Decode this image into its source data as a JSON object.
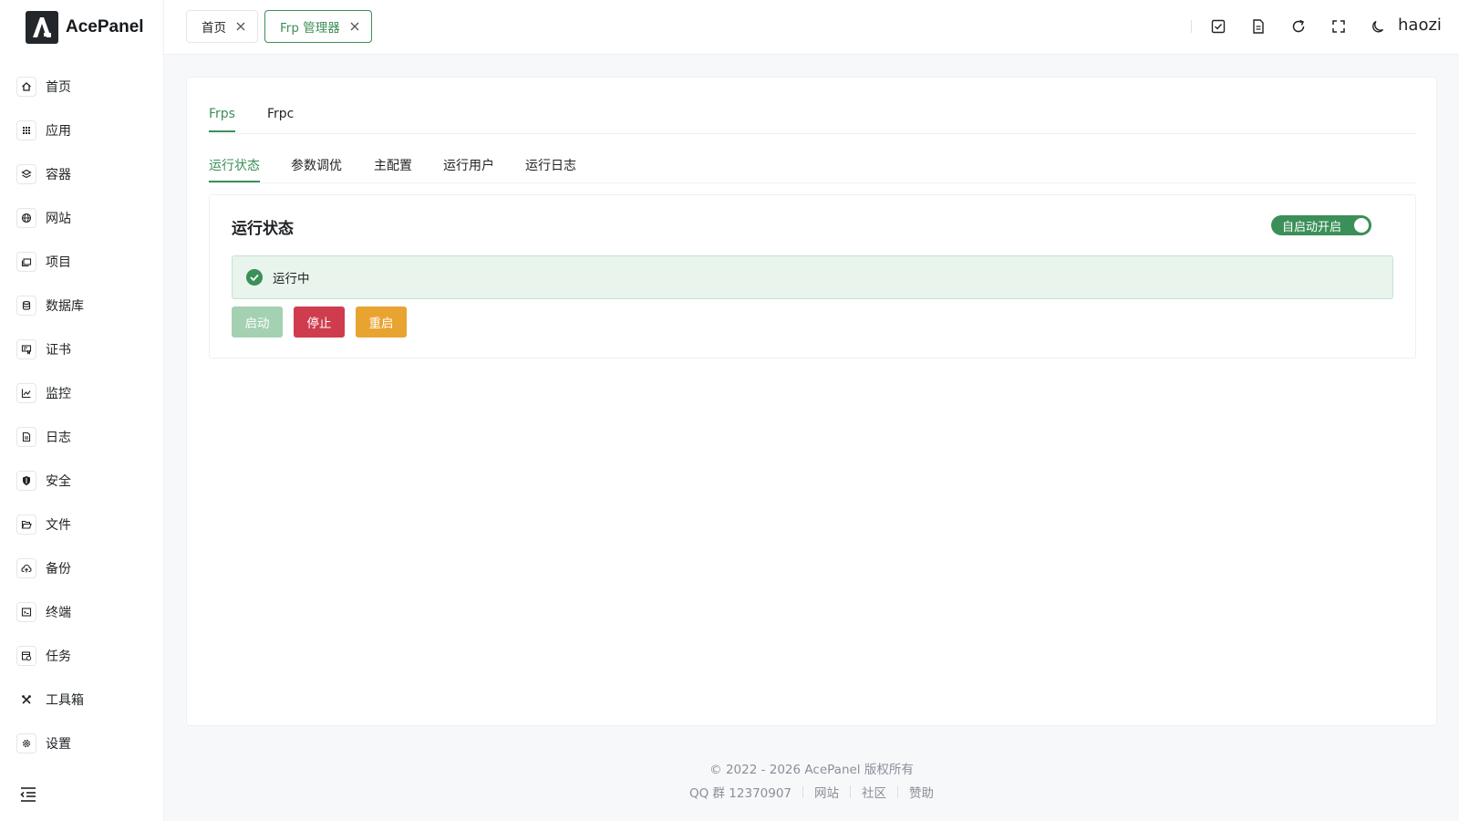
{
  "app": {
    "name": "AcePanel"
  },
  "sidebar": {
    "items": [
      {
        "label": "首页",
        "icon": "home-icon"
      },
      {
        "label": "应用",
        "icon": "apps-grid-icon"
      },
      {
        "label": "容器",
        "icon": "layers-icon"
      },
      {
        "label": "网站",
        "icon": "globe-icon"
      },
      {
        "label": "项目",
        "icon": "folders-icon"
      },
      {
        "label": "数据库",
        "icon": "database-icon"
      },
      {
        "label": "证书",
        "icon": "certificate-icon"
      },
      {
        "label": "监控",
        "icon": "chart-line-icon"
      },
      {
        "label": "日志",
        "icon": "file-text-icon"
      },
      {
        "label": "安全",
        "icon": "shield-icon"
      },
      {
        "label": "文件",
        "icon": "folder-open-icon"
      },
      {
        "label": "备份",
        "icon": "cloud-upload-icon"
      },
      {
        "label": "终端",
        "icon": "terminal-icon"
      },
      {
        "label": "任务",
        "icon": "task-calendar-icon"
      },
      {
        "label": "工具箱",
        "icon": "tools-icon"
      },
      {
        "label": "设置",
        "icon": "gear-icon"
      }
    ]
  },
  "header": {
    "tabs": [
      {
        "label": "首页"
      },
      {
        "label": "Frp 管理器"
      }
    ],
    "username": "haozi"
  },
  "main": {
    "top_tabs": [
      "Frps",
      "Frpc"
    ],
    "sub_tabs": [
      "运行状态",
      "参数调优",
      "主配置",
      "运行用户",
      "运行日志"
    ],
    "panel_title": "运行状态",
    "autostart_label": "自启动开启",
    "status_text": "运行中",
    "buttons": {
      "start": "启动",
      "stop": "停止",
      "restart": "重启"
    }
  },
  "footer": {
    "copyright": "© 2022 - 2026 AcePanel 版权所有",
    "qq": "QQ 群 12370907",
    "links": [
      "网站",
      "社区",
      "赞助"
    ]
  },
  "colors": {
    "accent": "#3b8f58",
    "danger": "#cf3c4e",
    "warning": "#e8a330"
  }
}
